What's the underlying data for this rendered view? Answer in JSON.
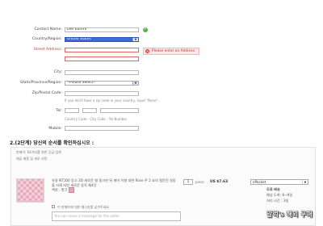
{
  "form": {
    "contact_name": {
      "label": "Contact Name:",
      "value": "Lee Eunmi"
    },
    "country": {
      "label": "Country/Region:",
      "value": "United States"
    },
    "street": {
      "label": "Street Address:",
      "error": "Please enter an Address"
    },
    "city": {
      "label": "City:"
    },
    "state": {
      "label": "State/Province/Region:",
      "value": "--Please Select--"
    },
    "zip": {
      "label": "Zip/Postal Code:",
      "hint": "If you don't have a zip code in your country, input \"None\"."
    },
    "tel": {
      "label": "Tel:",
      "hint": "Country Code - City Code - Tel Number"
    },
    "mobile": {
      "label": "Mobile:"
    }
  },
  "section2": {
    "title": "2.(2단계) 당신의 순서를 확인하십시오 :",
    "seller_line": "판매자: 64가지를 위한 공급 업체",
    "shipping_label": "제공 제품 및 세부 사항",
    "item_desc": "유용 NT100 등고 2D 새로운 형 핑크핀 뒤 헤어 이형 대한 Rose 주 2 요의 필문진 실동을 사례 자안 새로운 동작 제4단 ",
    "item_color": "색상 : 핑크",
    "qty": "1",
    "qty_unit": "piece",
    "price": "US $7.63",
    "ship_method": "ePacket",
    "ship_free": "무료 배송",
    "ship_time": "예상 도착: 6~9일",
    "ship_process": "처리 시간 : 3일",
    "message_checkbox": "이 판매자에 대한 메시지를 남겨주세요",
    "message_placeholder": "You can leave a message for the seller."
  },
  "watermark": "말럭's 해외 구매"
}
